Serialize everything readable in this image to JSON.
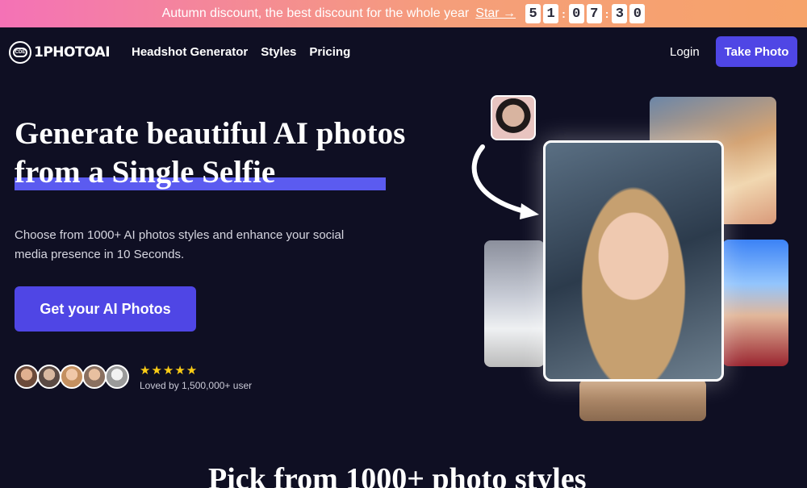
{
  "promo": {
    "text": "Autumn discount, the best discount for the whole year",
    "link": "Star →",
    "timer": [
      "5",
      "1",
      "0",
      "7",
      "3",
      "0"
    ]
  },
  "nav": {
    "logo_text": "1PHOTOAI",
    "logo_badge": "CDE",
    "links": [
      "Headshot Generator",
      "Styles",
      "Pricing"
    ],
    "login": "Login",
    "take_photo": "Take Photo"
  },
  "hero": {
    "headline_line1": "Generate beautiful AI photos",
    "headline_line2": "from a Single Selfie",
    "subtitle": "Choose from 1000+ AI photos styles and enhance your social media presence in 10 Seconds.",
    "cta": "Get your AI Photos",
    "stars": "★★★★★",
    "loved": "Loved by 1,500,000+ user"
  },
  "section": {
    "title": "Pick from 1000+ photo styles"
  },
  "colors": {
    "background": "#0f0f23",
    "accent": "#4f46e5",
    "underline": "#5b5bf0",
    "star": "#facc15"
  }
}
